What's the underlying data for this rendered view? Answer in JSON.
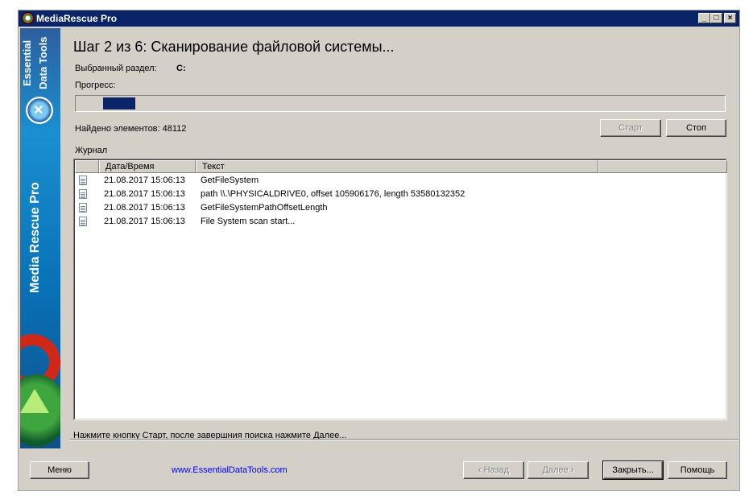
{
  "window": {
    "title": "MediaRescue Pro",
    "min": "_",
    "max": "□",
    "close": "×"
  },
  "sidebar": {
    "brand_top": "Essential Data Tools",
    "brand_main": "Media Rescue Pro"
  },
  "heading": "Шаг 2 из 6: Сканирование файловой системы...",
  "partition": {
    "label": "Выбранный раздел:",
    "value": "C:"
  },
  "progress": {
    "label": "Прогресс:",
    "fraction": 0.05
  },
  "found": "Найдено элементов: 48112",
  "buttons": {
    "start": "Старт",
    "stop": "Стоп",
    "menu": "Меню",
    "back": "‹ Назад",
    "next": "Далее ›",
    "close": "Закрыть...",
    "help": "Помощь"
  },
  "journal": {
    "label": "Журнал",
    "columns": [
      "",
      "Дата/Время",
      "Текст",
      ""
    ],
    "rows": [
      {
        "date": "21.08.2017 15:06:13",
        "text": "GetFileSystem"
      },
      {
        "date": "21.08.2017 15:06:13",
        "text": "path \\\\.\\PHYSICALDRIVE0, offset 105906176, length 53580132352"
      },
      {
        "date": "21.08.2017 15:06:13",
        "text": "GetFileSystemPathOffsetLength"
      },
      {
        "date": "21.08.2017 15:06:13",
        "text": "File System scan start..."
      }
    ]
  },
  "hint": "Нажмите кнопку Старт, после завершния поиска нажмите Далее...",
  "website": "www.EssentialDataTools.com"
}
